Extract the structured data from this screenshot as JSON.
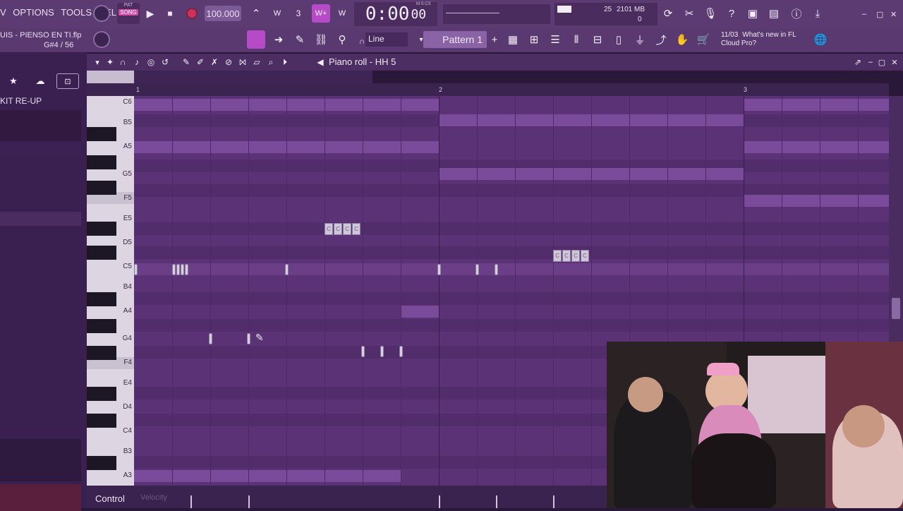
{
  "menu": [
    "V",
    "OPTIONS",
    "TOOLS",
    "HELP"
  ],
  "transport": {
    "pat_label": "PAT",
    "song_label": "SONG",
    "play_icon": "play-icon",
    "stop_icon": "stop-icon",
    "record_icon": "record-icon",
    "tempo": "100.000",
    "time": "0:00",
    "time_sub": "00",
    "time_unit": "M:S:CS"
  },
  "monitor": {
    "cpu": "25",
    "memory": "2101 MB",
    "poly": "0"
  },
  "project": {
    "filename": "UIS - PIENSO EN TI.flp",
    "position": "G#4 / 56"
  },
  "toolbar": {
    "mode": "Line",
    "pattern": "Pattern 1",
    "news_date": "11/03",
    "news_text": "What's new in FL Cloud Pro?"
  },
  "browser": {
    "item": "KIT RE-UP"
  },
  "piano_roll": {
    "title": "Piano roll - HH 5",
    "bars": [
      "1",
      "2",
      "3"
    ],
    "keys": [
      {
        "label": "C6"
      },
      {
        "label": "B5"
      },
      {
        "label": "A5"
      },
      {
        "label": "G5"
      },
      {
        "label": "F5"
      },
      {
        "label": "E5"
      },
      {
        "label": "D5"
      },
      {
        "label": "C5"
      },
      {
        "label": "B4"
      },
      {
        "label": "A4"
      },
      {
        "label": "G4"
      },
      {
        "label": "F4"
      },
      {
        "label": "E4"
      },
      {
        "label": "D4"
      },
      {
        "label": "C4"
      },
      {
        "label": "B3"
      },
      {
        "label": "A3"
      }
    ],
    "note_labels": [
      "C",
      "C",
      "C",
      "C",
      "C",
      "C",
      "C",
      "C"
    ]
  },
  "control": {
    "label": "Control",
    "target": "Velocity"
  },
  "colors": {
    "accent": "#b64bc8",
    "background": "#5a3275",
    "note": "#d6cfdd"
  }
}
